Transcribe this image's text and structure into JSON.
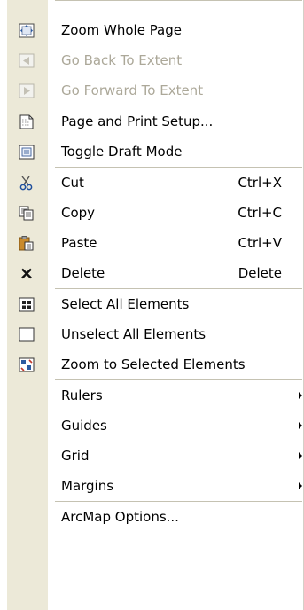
{
  "menu": {
    "items": [
      {
        "label": "Zoom Whole Page",
        "icon": "zoom-whole-page-icon",
        "enabled": true
      },
      {
        "label": "Go Back To Extent",
        "icon": "back-extent-icon",
        "enabled": false
      },
      {
        "label": "Go Forward To Extent",
        "icon": "forward-extent-icon",
        "enabled": false
      },
      {
        "label": "Page and Print Setup...",
        "icon": "page-setup-icon",
        "enabled": true
      },
      {
        "label": "Toggle Draft Mode",
        "icon": "draft-mode-icon",
        "enabled": true
      },
      {
        "label": "Cut",
        "shortcut": "Ctrl+X",
        "icon": "scissors-icon",
        "enabled": true
      },
      {
        "label": "Copy",
        "shortcut": "Ctrl+C",
        "icon": "copy-icon",
        "enabled": true
      },
      {
        "label": "Paste",
        "shortcut": "Ctrl+V",
        "icon": "paste-icon",
        "enabled": true
      },
      {
        "label": "Delete",
        "shortcut": "Delete",
        "icon": "delete-x-icon",
        "enabled": true
      },
      {
        "label": "Select All Elements",
        "icon": "select-all-icon",
        "enabled": true
      },
      {
        "label": "Unselect All Elements",
        "icon": "unselect-all-icon",
        "enabled": true
      },
      {
        "label": "Zoom to Selected Elements",
        "icon": "zoom-selected-icon",
        "enabled": true
      },
      {
        "label": "Rulers",
        "submenu": true,
        "enabled": true
      },
      {
        "label": "Guides",
        "submenu": true,
        "enabled": true
      },
      {
        "label": "Grid",
        "submenu": true,
        "enabled": true
      },
      {
        "label": "Margins",
        "submenu": true,
        "enabled": true
      },
      {
        "label": "ArcMap Options...",
        "enabled": true
      }
    ]
  },
  "colors": {
    "disabled_text": "#aca899",
    "gutter": "#ece9d8",
    "separator": "#c5c2b2"
  }
}
